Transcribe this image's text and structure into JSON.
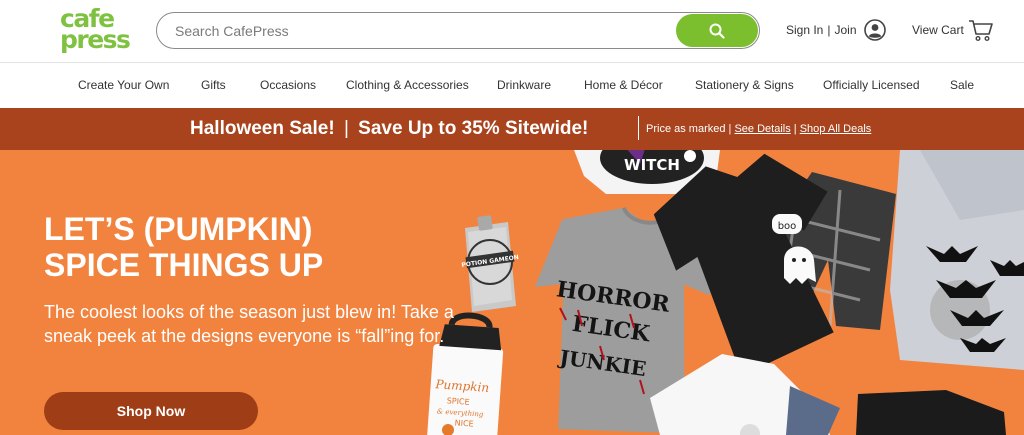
{
  "brand": {
    "logo_line1": "cafe",
    "logo_line2": "press",
    "logo_color": "#7fc241"
  },
  "search": {
    "placeholder": "Search CafePress",
    "value": "",
    "button_icon": "search-icon",
    "button_color": "#7bbf2e"
  },
  "account": {
    "signin_label": "Sign In",
    "separator": "|",
    "join_label": "Join",
    "icon": "user-circle-icon"
  },
  "cart": {
    "label": "View Cart",
    "icon": "cart-icon"
  },
  "nav": {
    "items": [
      "Create Your Own",
      "Gifts",
      "Occasions",
      "Clothing & Accessories",
      "Drinkware",
      "Home & Décor",
      "Stationery & Signs",
      "Officially Licensed",
      "Sale"
    ]
  },
  "promo": {
    "headline_left": "Halloween Sale!",
    "headline_right": "Save Up to 35% Sitewide!",
    "price_note": "Price as marked",
    "see_details": "See Details",
    "shop_all": "Shop All Deals",
    "divider": "|",
    "background": "#a8431d"
  },
  "hero": {
    "headline_line1": "LET’S (PUMPKIN)",
    "headline_line2": "SPICE THINGS UP",
    "subtext": "The coolest looks of the season just blew in! Take a sneak peek at the designs everyone is “fall”ing for.",
    "cta_label": "Shop Now",
    "background": "#f2833e",
    "cta_color": "#9f3d16",
    "product_texts": {
      "tshirt_line1": "HORROR",
      "tshirt_line2": "FLICK",
      "tshirt_line3": "JUNKIE",
      "flask_text": "POTION GAMEON",
      "mug_line1": "Pumpkin",
      "mug_line2": "SPICE",
      "mug_line3": "& everything",
      "mug_line4": "NICE",
      "boo_text": "boo",
      "witch_text": "WITCH"
    }
  }
}
